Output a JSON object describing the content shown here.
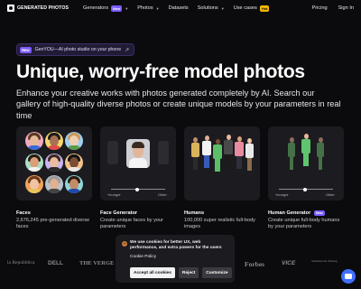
{
  "nav": {
    "brand": "GENERATED PHOTOS",
    "items": [
      {
        "label": "Generators",
        "badge": "New",
        "chevron": true
      },
      {
        "label": "Photos",
        "badge": "",
        "chevron": true
      },
      {
        "label": "Datasets",
        "badge": "",
        "chevron": false
      },
      {
        "label": "Solutions",
        "badge": "",
        "chevron": true
      },
      {
        "label": "Use cases",
        "badge": "Hot",
        "chevron": false
      }
    ],
    "pricing": "Pricing",
    "signin": "Sign In"
  },
  "promo": {
    "badge": "New",
    "text": "GenYOU—AI photo studio on your phone",
    "arrow": "↗"
  },
  "hero": {
    "title": "Unique, worry-free model photos",
    "subtitle": "Enhance your creative works with photos generated completely by AI. Search our gallery of high-quality diverse photos or create unique models by your parameters in real time"
  },
  "cards": [
    {
      "label": "Faces",
      "desc": "2,676,245 pre-generated diverse faces",
      "badge": ""
    },
    {
      "label": "Face Generator",
      "desc": "Create unique faces by your parameters",
      "badge": "",
      "slider_left": "Younger",
      "slider_right": "Older"
    },
    {
      "label": "Humans",
      "desc": "100,000 super realistic full-body images",
      "badge": ""
    },
    {
      "label": "Human Generator",
      "desc": "Create unique full-body humans by your parameters",
      "badge": "New",
      "slider_left": "Younger",
      "slider_right": "Older"
    }
  ],
  "cookie": {
    "text": "We use cookies for better UX, web performance, and extra powers for the users",
    "policy": "Cookie Policy",
    "accept": "Accept all cookies",
    "reject": "Reject",
    "customize": "Customize"
  },
  "press_logos": [
    "la Repubblica",
    "DELL",
    "THE VERGE",
    "Forbes",
    "VICE",
    "Süddeutsche Zeitung"
  ],
  "colors": {
    "accent": "#7b5cff",
    "hot": "#f5b800",
    "chat": "#3f6fff"
  }
}
